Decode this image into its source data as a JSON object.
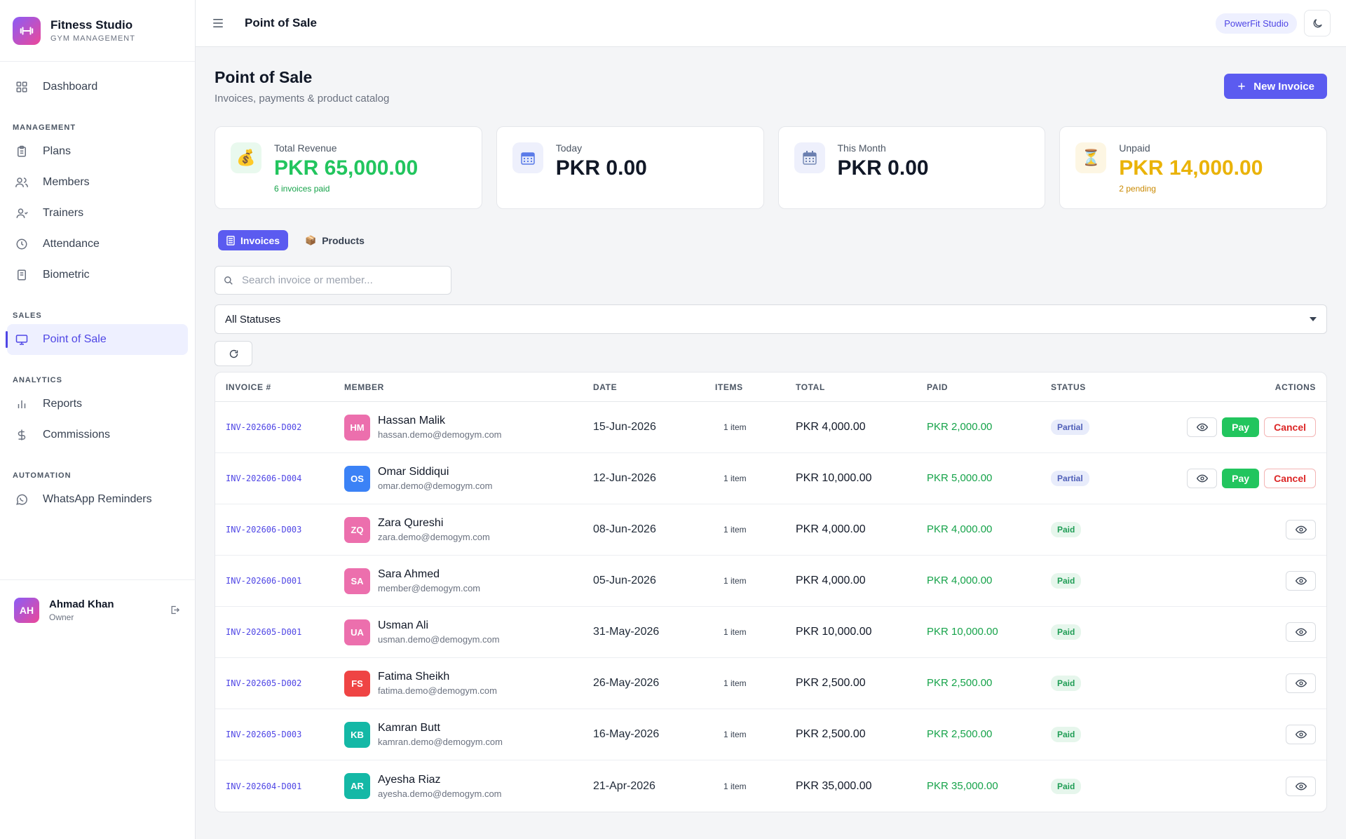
{
  "brand": {
    "title": "Fitness Studio",
    "subtitle": "GYM MANAGEMENT"
  },
  "sidebar": {
    "dashboard": "Dashboard",
    "sections": {
      "management": "MANAGEMENT",
      "sales": "SALES",
      "analytics": "ANALYTICS",
      "automation": "AUTOMATION"
    },
    "items": {
      "plans": "Plans",
      "members": "Members",
      "trainers": "Trainers",
      "attendance": "Attendance",
      "biometric": "Biometric",
      "pos": "Point of Sale",
      "reports": "Reports",
      "commissions": "Commissions",
      "whatsapp": "WhatsApp Reminders"
    },
    "active": "pos"
  },
  "user": {
    "initials": "AH",
    "name": "Ahmad Khan",
    "role": "Owner"
  },
  "topbar": {
    "title": "Point of Sale",
    "studio": "PowerFit Studio"
  },
  "page": {
    "title": "Point of Sale",
    "subtitle": "Invoices, payments & product catalog",
    "new_invoice": "New Invoice"
  },
  "stats": [
    {
      "label": "Total Revenue",
      "value": "PKR 65,000.00",
      "note": "6 invoices paid",
      "icon": "money-bag-icon",
      "color": "#22c55e"
    },
    {
      "label": "Today",
      "value": "PKR 0.00",
      "note": "",
      "icon": "calendar-icon",
      "color": "#111827"
    },
    {
      "label": "This Month",
      "value": "PKR 0.00",
      "note": "",
      "icon": "calendar-month-icon",
      "color": "#111827"
    },
    {
      "label": "Unpaid",
      "value": "PKR 14,000.00",
      "note": "2 pending",
      "icon": "hourglass-icon",
      "color": "#eab308"
    }
  ],
  "tabs": {
    "invoices": "Invoices",
    "products": "Products"
  },
  "search": {
    "placeholder": "Search invoice or member..."
  },
  "status_filter": {
    "selected": "All Statuses"
  },
  "table": {
    "headers": [
      "INVOICE #",
      "MEMBER",
      "DATE",
      "ITEMS",
      "TOTAL",
      "PAID",
      "STATUS",
      "ACTIONS"
    ],
    "pay_label": "Pay",
    "cancel_label": "Cancel",
    "rows": [
      {
        "invoice": "INV-202606-D002",
        "initials": "HM",
        "avatar_color": "#ec6fad",
        "name": "Hassan Malik",
        "email": "hassan.demo@demogym.com",
        "date": "15-Jun-2026",
        "items": "1 item",
        "total": "PKR 4,000.00",
        "paid": "PKR 2,000.00",
        "status": "Partial"
      },
      {
        "invoice": "INV-202606-D004",
        "initials": "OS",
        "avatar_color": "#3b82f6",
        "name": "Omar Siddiqui",
        "email": "omar.demo@demogym.com",
        "date": "12-Jun-2026",
        "items": "1 item",
        "total": "PKR 10,000.00",
        "paid": "PKR 5,000.00",
        "status": "Partial"
      },
      {
        "invoice": "INV-202606-D003",
        "initials": "ZQ",
        "avatar_color": "#ec6fad",
        "name": "Zara Qureshi",
        "email": "zara.demo@demogym.com",
        "date": "08-Jun-2026",
        "items": "1 item",
        "total": "PKR 4,000.00",
        "paid": "PKR 4,000.00",
        "status": "Paid"
      },
      {
        "invoice": "INV-202606-D001",
        "initials": "SA",
        "avatar_color": "#ec6fad",
        "name": "Sara Ahmed",
        "email": "member@demogym.com",
        "date": "05-Jun-2026",
        "items": "1 item",
        "total": "PKR 4,000.00",
        "paid": "PKR 4,000.00",
        "status": "Paid"
      },
      {
        "invoice": "INV-202605-D001",
        "initials": "UA",
        "avatar_color": "#ec6fad",
        "name": "Usman Ali",
        "email": "usman.demo@demogym.com",
        "date": "31-May-2026",
        "items": "1 item",
        "total": "PKR 10,000.00",
        "paid": "PKR 10,000.00",
        "status": "Paid"
      },
      {
        "invoice": "INV-202605-D002",
        "initials": "FS",
        "avatar_color": "#ef4444",
        "name": "Fatima Sheikh",
        "email": "fatima.demo@demogym.com",
        "date": "26-May-2026",
        "items": "1 item",
        "total": "PKR 2,500.00",
        "paid": "PKR 2,500.00",
        "status": "Paid"
      },
      {
        "invoice": "INV-202605-D003",
        "initials": "KB",
        "avatar_color": "#14b8a6",
        "name": "Kamran Butt",
        "email": "kamran.demo@demogym.com",
        "date": "16-May-2026",
        "items": "1 item",
        "total": "PKR 2,500.00",
        "paid": "PKR 2,500.00",
        "status": "Paid"
      },
      {
        "invoice": "INV-202604-D001",
        "initials": "AR",
        "avatar_color": "#14b8a6",
        "name": "Ayesha Riaz",
        "email": "ayesha.demo@demogym.com",
        "date": "21-Apr-2026",
        "items": "1 item",
        "total": "PKR 35,000.00",
        "paid": "PKR 35,000.00",
        "status": "Paid"
      }
    ]
  }
}
